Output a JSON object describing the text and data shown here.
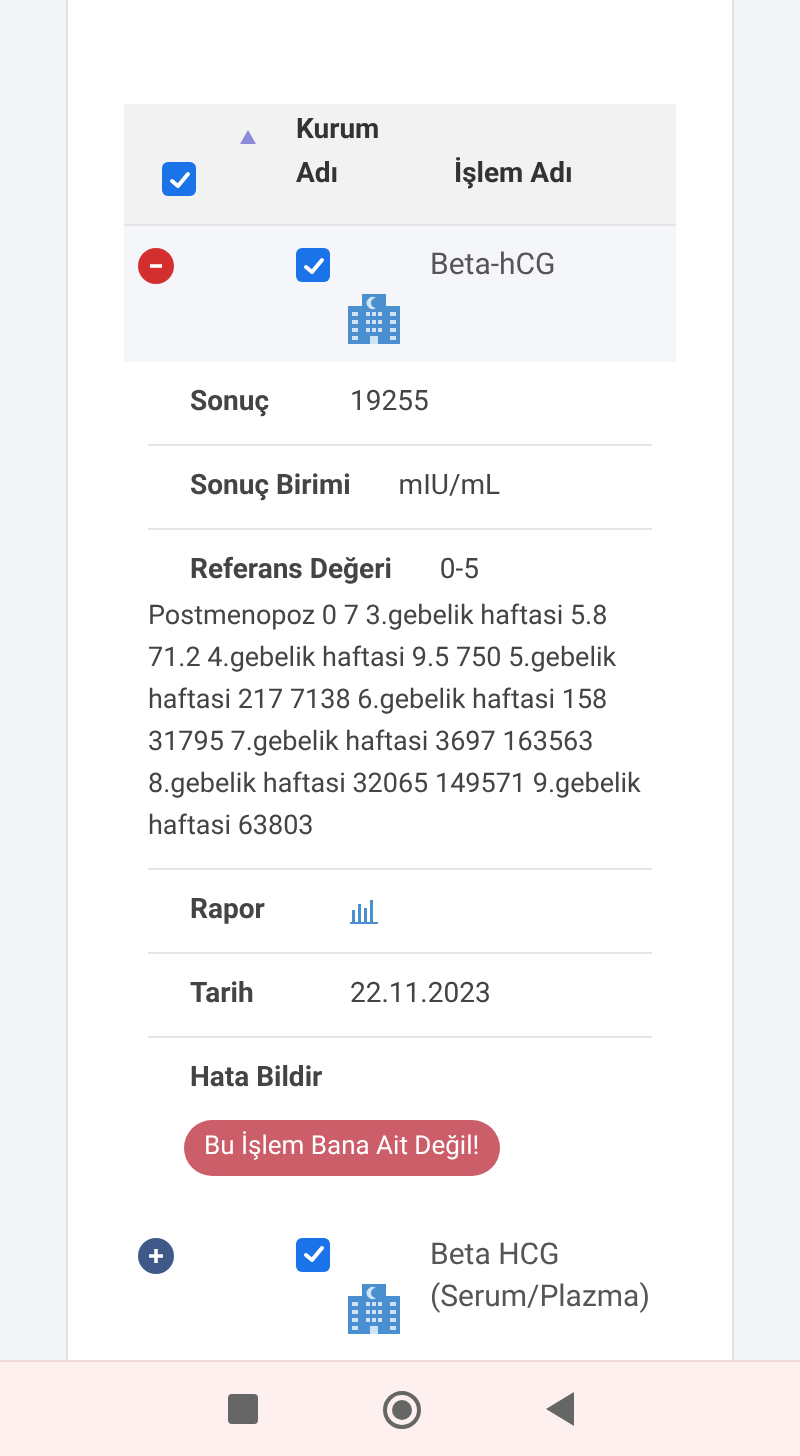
{
  "table": {
    "header": {
      "select_all_checked": true,
      "sort_ascending": true,
      "columns": [
        "Kurum Adı",
        "İşlem Adı"
      ]
    },
    "rows": [
      {
        "expanded": true,
        "checked": true,
        "name": "Beta-hCG",
        "details": [
          {
            "kind": "text",
            "label": "Sonuç",
            "value": "19255"
          },
          {
            "kind": "text",
            "label": "Sonuç Birimi",
            "value": "mIU/mL"
          },
          {
            "kind": "note",
            "label": "Referans Değeri",
            "value": "0-5",
            "note": "Postmenopoz 0 7 3.gebelik haftasi 5.8 71.2 4.gebelik haftasi 9.5 750 5.gebelik haftasi 217 7138 6.gebelik haftasi 158 31795 7.gebelik haftasi 3697 163563 8.gebelik haftasi 32065 149571 9.gebelik haftasi 63803"
          },
          {
            "kind": "report",
            "label": "Rapor"
          },
          {
            "kind": "text",
            "label": "Tarih",
            "value": "22.11.2023"
          },
          {
            "kind": "button",
            "label": "Hata Bildir",
            "button": "Bu İşlem Bana Ait Değil!"
          }
        ]
      },
      {
        "expanded": false,
        "checked": true,
        "name": "Beta HCG (Serum/Plazma)"
      }
    ]
  }
}
